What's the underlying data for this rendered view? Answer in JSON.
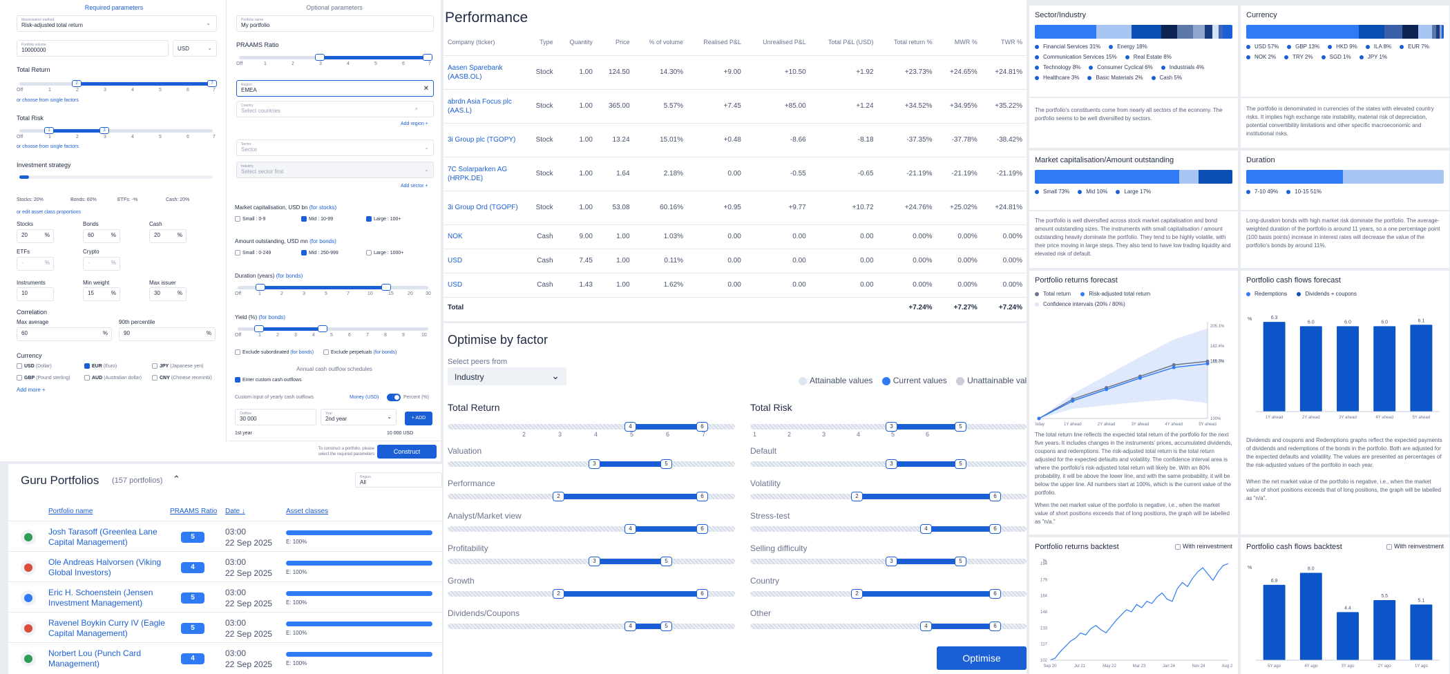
{
  "builder": {
    "required_title": "Required parameters",
    "optional_title": "Optional parameters",
    "maximisation_label": "Maximisation method",
    "maximisation_value": "Risk-adjusted total return",
    "amount_label": "Portfolio volume",
    "amount_value": "10000000",
    "currency_value": "USD",
    "total_return_title": "Total Return",
    "total_return_range": [
      "2",
      "7"
    ],
    "total_risk_title": "Total Risk",
    "total_risk_range": [
      "1",
      "3"
    ],
    "choose_factors": "or choose from single factors",
    "scale_ticks": [
      "Off",
      "1",
      "2",
      "3",
      "4",
      "5",
      "6",
      "7"
    ],
    "investment_strategy_title": "Investment strategy",
    "strategy_summary": [
      "Stocks:  20%",
      "Bonds:  60%",
      "ETFs:  -%",
      "Cash:  20%"
    ],
    "strategy_link": "or edit asset class proportions",
    "alloc": [
      {
        "label": "Stocks",
        "value": "20"
      },
      {
        "label": "Bonds",
        "value": "60"
      },
      {
        "label": "Cash",
        "value": "20"
      },
      {
        "label": "ETFs",
        "value": "-"
      },
      {
        "label": "Crypto",
        "value": "-"
      }
    ],
    "instruments_label": "Instruments",
    "instruments_value": "10",
    "min_weight_label": "Min weight",
    "min_weight_value": "15",
    "max_issuer_label": "Max issuer",
    "max_issuer_value": "30",
    "correlation_title": "Correlation",
    "max_average_label": "Max average",
    "max_average_value": "60",
    "percentile_label": "90th percentile",
    "percentile_value": "90",
    "currency_title": "Currency",
    "currencies": [
      {
        "code": "USD",
        "name": "(Dollar)",
        "checked": false
      },
      {
        "code": "EUR",
        "name": "(Euro)",
        "checked": true
      },
      {
        "code": "JPY",
        "name": "(Japanese yen)",
        "checked": false
      },
      {
        "code": "GBP",
        "name": "(Pound sterling)",
        "checked": false
      },
      {
        "code": "AUD",
        "name": "(Australian dollar)",
        "checked": false
      },
      {
        "code": "CNY",
        "name": "(Chinese renminbi)",
        "checked": false
      }
    ],
    "add_more": "Add more",
    "portfolio_name_label": "Portfolio name",
    "portfolio_name_value": "My portfolio",
    "praams_ratio_title": "PRAAMS Ratio",
    "region_label": "Region",
    "region_value": "EMEA",
    "country_label": "Country",
    "country_placeholder": "Select countries",
    "add_region": "Add region",
    "sector_label": "Sector",
    "sector_placeholder": "Sector",
    "industry_label": "Industry",
    "industry_placeholder": "Select sector first",
    "add_sector": "Add sector",
    "market_cap_title": "Market capitalisation, USD bn",
    "for_stocks": "(for stocks)",
    "market_cap_opts": [
      {
        "label": "Small : 0-9",
        "checked": false
      },
      {
        "label": "Mid : 10-99",
        "checked": true
      },
      {
        "label": "Large : 100+",
        "checked": true
      }
    ],
    "amount_out_title": "Amount outstanding, USD mn",
    "for_bonds": "(for bonds)",
    "amount_out_opts": [
      {
        "label": "Small : 0-249",
        "checked": false
      },
      {
        "label": "Mid : 250-999",
        "checked": true
      },
      {
        "label": "Large : 1000+",
        "checked": false
      }
    ],
    "duration_title": "Duration (years)",
    "duration_ticks": [
      "Off",
      "1",
      "2",
      "3",
      "5",
      "7",
      "10",
      "15",
      "20",
      "30"
    ],
    "yield_title": "Yield (%)",
    "yield_ticks": [
      "Off",
      "1",
      "2",
      "3",
      "4",
      "5",
      "6",
      "7",
      "8",
      "9",
      "10"
    ],
    "exclude_subordinated": "Exclude subordinated",
    "exclude_perpetuals": "Exclude perpetuals",
    "annual_cash_title": "Annual cash outflow schedules",
    "enter_custom": "Enter custom cash outflows",
    "custom_input_label": "Custom input of yearly cash outflows",
    "money_label": "Money (USD)",
    "percent_label": "Percent (%)",
    "outflow_label": "Outflow",
    "outflow_value": "30 000",
    "year_label": "Year",
    "year_value": "2nd year",
    "add_btn": "+ ADD",
    "first_year": "1st year",
    "first_year_value": "10 000 USD",
    "construct_hint": "To construct a portfolio, please select the required parameters",
    "construct_btn": "Construct"
  },
  "guru": {
    "title": "Guru Portfolios",
    "count": "(157 portfolios)",
    "region_label": "Region",
    "region_value": "All",
    "columns": [
      "Portfolio name",
      "PRAAMS Ratio",
      "Date",
      "Asset classes"
    ],
    "rows": [
      {
        "name": "Josh Tarasoff (Greenlea Lane Capital Management)",
        "ratio": "5",
        "time": "03:00",
        "date": "22 Sep 2025",
        "asset": "E: 100%"
      },
      {
        "name": "Ole Andreas Halvorsen (Viking Global Investors)",
        "ratio": "4",
        "time": "03:00",
        "date": "22 Sep 2025",
        "asset": "E: 100%"
      },
      {
        "name": "Eric H. Schoenstein (Jensen Investment Management)",
        "ratio": "5",
        "time": "03:00",
        "date": "22 Sep 2025",
        "asset": "E: 100%"
      },
      {
        "name": "Ravenel Boykin Curry IV (Eagle Capital Management)",
        "ratio": "5",
        "time": "03:00",
        "date": "22 Sep 2025",
        "asset": "E: 100%"
      },
      {
        "name": "Norbert Lou (Punch Card Management)",
        "ratio": "4",
        "time": "03:00",
        "date": "22 Sep 2025",
        "asset": "E: 100%"
      }
    ]
  },
  "performance": {
    "title": "Performance",
    "columns": [
      "Company (ticker)",
      "Type",
      "Quantity",
      "Price",
      "% of volume",
      "Realised P&L",
      "Unrealised P&L",
      "Total P&L (USD)",
      "Total return %",
      "MWR %",
      "TWR %"
    ],
    "rows": [
      [
        "Aasen Sparebank (AASB.OL)",
        "Stock",
        "1.00",
        "124.50",
        "14.30%",
        "+9.00",
        "+10.50",
        "+1.92",
        "+23.73%",
        "+24.65%",
        "+24.81%"
      ],
      [
        "abrdn Asia Focus plc (AAS.L)",
        "Stock",
        "1.00",
        "365.00",
        "5.57%",
        "+7.45",
        "+85.00",
        "+1.24",
        "+34.52%",
        "+34.95%",
        "+35.22%"
      ],
      [
        "3i Group plc (TGOPY)",
        "Stock",
        "1.00",
        "13.24",
        "15.01%",
        "+0.48",
        "-8.66",
        "-8.18",
        "-37.35%",
        "-37.78%",
        "-38.42%"
      ],
      [
        "7C Solarparken AG (HRPK.DE)",
        "Stock",
        "1.00",
        "1.64",
        "2.18%",
        "0.00",
        "-0.55",
        "-0.65",
        "-21.19%",
        "-21.19%",
        "-21.19%"
      ],
      [
        "3i Group Ord (TGOPF)",
        "Stock",
        "1.00",
        "53.08",
        "60.16%",
        "+0.95",
        "+9.77",
        "+10.72",
        "+24.76%",
        "+25.02%",
        "+24.81%"
      ],
      [
        "NOK",
        "Cash",
        "9.00",
        "1.00",
        "1.03%",
        "0.00",
        "0.00",
        "0.00",
        "0.00%",
        "0.00%",
        "0.00%"
      ],
      [
        "USD",
        "Cash",
        "7.45",
        "1.00",
        "0.11%",
        "0.00",
        "0.00",
        "0.00",
        "0.00%",
        "0.00%",
        "0.00%"
      ],
      [
        "USD",
        "Cash",
        "1.43",
        "1.00",
        "1.62%",
        "0.00",
        "0.00",
        "0.00",
        "0.00%",
        "0.00%",
        "0.00%"
      ]
    ],
    "total_label": "Total",
    "totals": [
      "+7.24%",
      "+7.27%",
      "+7.24%"
    ]
  },
  "optimise": {
    "title": "Optimise by factor",
    "peers_label": "Select peers from",
    "peers_value": "Industry",
    "legend": [
      "Attainable values",
      "Current values",
      "Unattainable values"
    ],
    "total_return": "Total Return",
    "total_risk": "Total Risk",
    "ticks_left": [
      "",
      "2",
      "3",
      "4",
      "5",
      "6",
      "7"
    ],
    "ticks_right": [
      "1",
      "2",
      "3",
      "4",
      "5",
      "6"
    ],
    "factors_left": [
      {
        "label": "Valuation",
        "lo": 3,
        "hi": 5
      },
      {
        "label": "Performance",
        "lo": 2,
        "hi": 6
      },
      {
        "label": "Analyst/Market view",
        "lo": 4,
        "hi": 6
      },
      {
        "label": "Profitability",
        "lo": 3,
        "hi": 5
      },
      {
        "label": "Growth",
        "lo": 2,
        "hi": 6
      },
      {
        "label": "Dividends/Coupons",
        "lo": 4,
        "hi": 5
      }
    ],
    "factors_right": [
      {
        "label": "Default",
        "lo": 3,
        "hi": 5
      },
      {
        "label": "Volatility",
        "lo": 2,
        "hi": 6
      },
      {
        "label": "Stress-test",
        "lo": 4,
        "hi": 6
      },
      {
        "label": "Selling difficulty",
        "lo": 3,
        "hi": 5
      },
      {
        "label": "Country",
        "lo": 2,
        "hi": 6
      },
      {
        "label": "Other",
        "lo": 4,
        "hi": 6
      }
    ],
    "tr_range": [
      4,
      6
    ],
    "risk_range": [
      3,
      5
    ],
    "optimise_btn": "Optimise"
  },
  "analytics": {
    "sector": {
      "title": "Sector/Industry",
      "legend": [
        "Financial Services 31%",
        "Energy 18%",
        "Communication Services 15%",
        "Real Estate 8%",
        "Technology 8%",
        "Consumer Cyclical 6%",
        "Industrials 4%",
        "Healthcare 3%",
        "Basic Materials 2%",
        "Cash 5%"
      ],
      "text": "The portfolio's constituents come from nearly all sectors of the economy. The portfolio seems to be well diversified by sectors."
    },
    "currency": {
      "title": "Currency",
      "legend": [
        "USD 57%",
        "GBP 13%",
        "HKD 9%",
        "ILA 8%",
        "EUR 7%",
        "NOK 2%",
        "TRY 2%",
        "SGD 1%",
        "JPY 1%"
      ],
      "text": "The portfolio is denominated in currencies of the states with elevated country risks. It implies high exchange rate instability, material risk of depreciation, potential convertibility limitations and other specific macroeconomic and institutional risks."
    },
    "mcap": {
      "title": "Market capitalisation/Amount outstanding",
      "legend": [
        "Small 73%",
        "Mid 10%",
        "Large 17%"
      ],
      "text": "The portfolio is well diversified across stock market capitalisation and bond amount outstanding sizes. The instruments with small capitalisation / amount outstanding heavily dominate the portfolio. They tend to be highly volatile, with their price moving in large steps. They also tend to have low trading liquidity and elevated risk of default."
    },
    "duration": {
      "title": "Duration",
      "legend": [
        "7-10 49%",
        "10-15 51%"
      ],
      "text": "Long-duration bonds with high market risk dominate the portfolio. The average-weighted duration of the portfolio is around 11 years, so a one percentage point (100 basis points) increase in interest rates will decrease the value of the portfolio's bonds by around 11%."
    },
    "returns_forecast": {
      "title": "Portfolio returns forecast",
      "legend": [
        "Total return",
        "Risk-adjusted total return",
        "Confidence intervals (20% / 80%)"
      ],
      "text1": "The total return line reflects the expected total return of the portfolio for the next five years. It includes changes in the instruments' prices, accumulated dividends, coupons and redemptions. The risk-adjusted total return is the total return adjusted for the expected defaults and volatility. The confidence interval area is where the portfolio's risk-adjusted total return will likely be. With an 80% probability, it will be above the lower line, and with the same probability, it will be below the upper line. All numbers start at 100%, which is the current value of the portfolio.",
      "text2": "When the net market value of the portfolio is negative, i.e., when the market value of short positions exceeds that of long positions, the graph will be labelled as \"n/a.\""
    },
    "cashflow_forecast": {
      "title": "Portfolio cash flows forecast",
      "legend": [
        "Redemptions",
        "Dividends + coupons"
      ],
      "text1": "Dividends and coupons and Redemptions graphs reflect the expected payments of dividends and redemptions of the bonds in the portfolio. Both are adjusted for the expected defaults and volatility. The values are presented as percentages of the risk-adjusted values of the portfolio in each year.",
      "text2": "When the net market value of the portfolio is negative, i.e., when the market value of short positions exceeds that of long positions, the graph will be labelled as \"n/a\"."
    },
    "returns_backtest": {
      "title": "Portfolio returns backtest",
      "reinvest": "With reinvestment"
    },
    "cashflow_backtest": {
      "title": "Portfolio cash flows backtest",
      "reinvest": "With reinvestment"
    }
  },
  "chart_data": [
    {
      "type": "line",
      "title": "Portfolio returns forecast",
      "categories": [
        "Today",
        "1Y ahead",
        "2Y ahead",
        "3Y ahead",
        "4Y ahead",
        "5Y ahead"
      ],
      "series": [
        {
          "name": "Total return",
          "values": [
            100,
            122,
            135,
            148,
            161,
            165.0
          ]
        },
        {
          "name": "Risk-adjusted total return",
          "values": [
            100,
            120,
            133,
            146,
            158,
            162.4
          ]
        }
      ],
      "y_tick_labels": [
        "100%",
        "165.7%",
        "182.4%",
        "165.0%",
        "205.1%"
      ],
      "ylabel_unit": "%"
    },
    {
      "type": "bar",
      "title": "Portfolio cash flows forecast",
      "categories": [
        "1Y ahead",
        "2Y ahead",
        "3Y ahead",
        "4Y ahead",
        "5Y ahead"
      ],
      "values": [
        6.3,
        6.0,
        6.0,
        6.0,
        6.1
      ],
      "ylabel": "%"
    },
    {
      "type": "line",
      "title": "Portfolio returns backtest",
      "x_tick_labels": [
        "Sep 20",
        "Jul 21",
        "May 22",
        "Mar 23",
        "Jan 24",
        "Nov 24",
        "Aug 25"
      ],
      "y_tick_labels": [
        "102",
        "117",
        "133",
        "148",
        "164",
        "179",
        "194"
      ],
      "ylabel": "%"
    },
    {
      "type": "bar",
      "title": "Portfolio cash flows backtest",
      "categories": [
        "5Y ago",
        "4Y ago",
        "3Y ago",
        "2Y ago",
        "1Y ago"
      ],
      "values": [
        6.9,
        8.0,
        4.4,
        5.5,
        5.1
      ],
      "ylabel": "%"
    }
  ]
}
